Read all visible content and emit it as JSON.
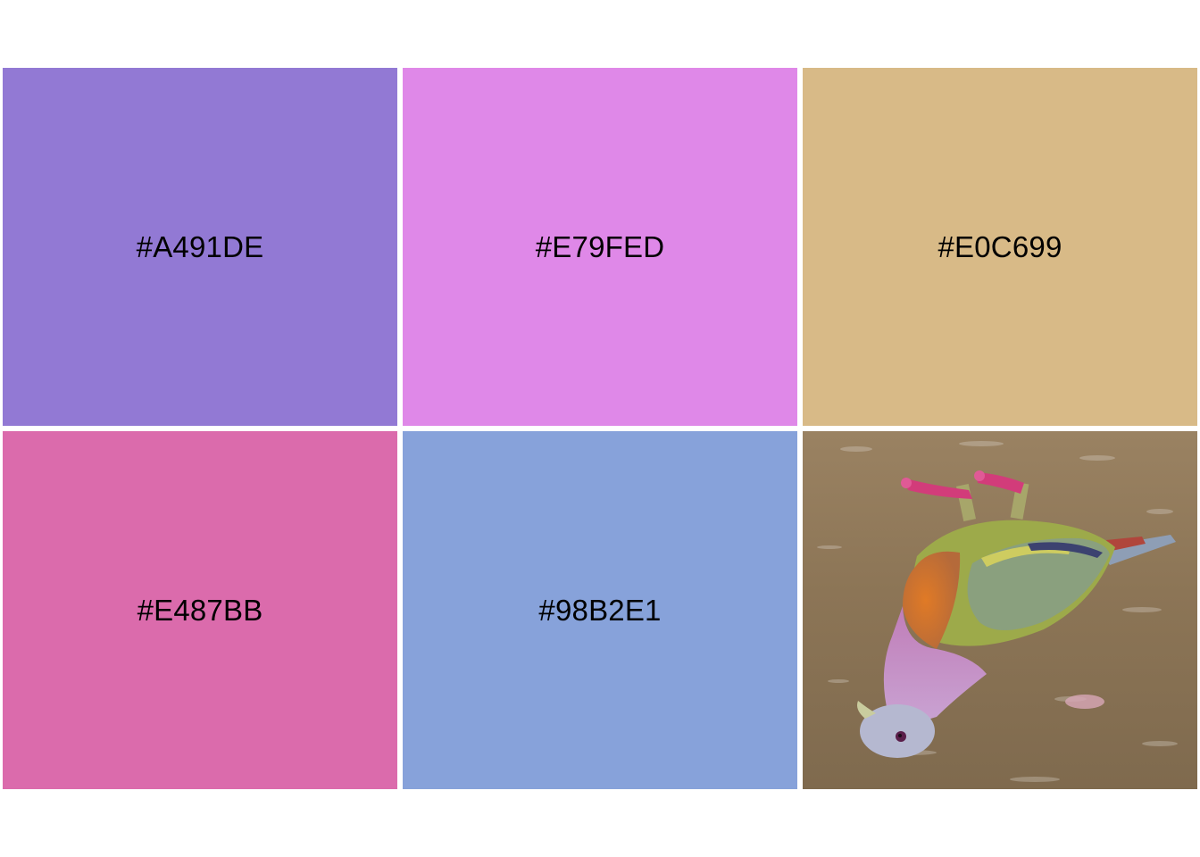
{
  "swatches": [
    {
      "label": "#A491DE",
      "fill": "#9279D4"
    },
    {
      "label": "#E79FED",
      "fill": "#DF88E8"
    },
    {
      "label": "#E0C699",
      "fill": "#D8BA87"
    },
    {
      "label": "#E487BB",
      "fill": "#DB6BAC"
    },
    {
      "label": "#98B2E1",
      "fill": "#87A2DA"
    }
  ],
  "photo": {
    "subject": "pink-necked green pigeon (upside down)",
    "colors": {
      "ground": "#8C7556",
      "body_green": "#9DAA4A",
      "wing": "#8AA07E",
      "head": "#B5B8D0",
      "neck_pink": "#C48CC6",
      "breast_orange": "#D47A2C",
      "feet": "#D23C7A",
      "tail": "#8E9EB5"
    }
  }
}
